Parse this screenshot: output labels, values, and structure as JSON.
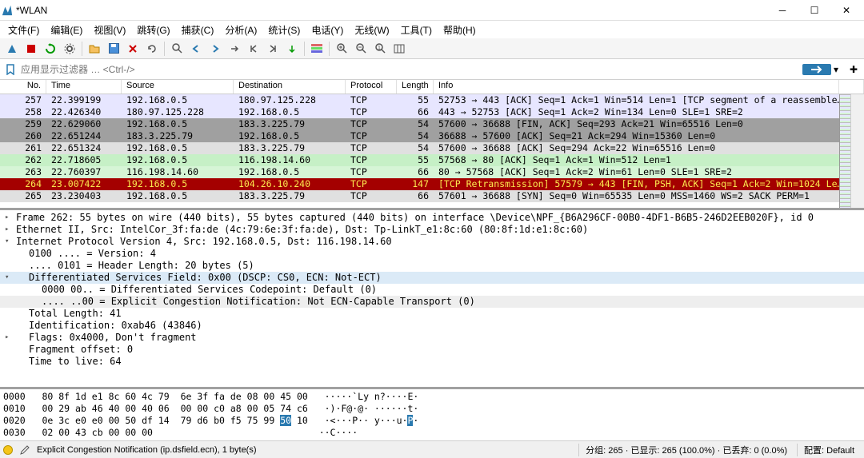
{
  "title": "*WLAN",
  "menus": [
    "文件(F)",
    "编辑(E)",
    "视图(V)",
    "跳转(G)",
    "捕获(C)",
    "分析(A)",
    "统计(S)",
    "电话(Y)",
    "无线(W)",
    "工具(T)",
    "帮助(H)"
  ],
  "filter_placeholder": "应用显示过滤器 … <Ctrl-/>",
  "columns": {
    "no": "No.",
    "time": "Time",
    "src": "Source",
    "dst": "Destination",
    "prot": "Protocol",
    "len": "Length",
    "info": "Info"
  },
  "packets": [
    {
      "no": "257",
      "time": "22.399199",
      "src": "192.168.0.5",
      "dst": "180.97.125.228",
      "prot": "TCP",
      "len": "55",
      "info": "52753 → 443 [ACK] Seq=1 Ack=1 Win=514 Len=1 [TCP segment of a reassemble…",
      "cls": "row-lavender"
    },
    {
      "no": "258",
      "time": "22.426340",
      "src": "180.97.125.228",
      "dst": "192.168.0.5",
      "prot": "TCP",
      "len": "66",
      "info": "443 → 52753 [ACK] Seq=1 Ack=2 Win=134 Len=0 SLE=1 SRE=2",
      "cls": "row-lavender"
    },
    {
      "no": "259",
      "time": "22.629060",
      "src": "192.168.0.5",
      "dst": "183.3.225.79",
      "prot": "TCP",
      "len": "54",
      "info": "57600 → 36688 [FIN, ACK] Seq=293 Ack=21 Win=65516 Len=0",
      "cls": "row-gray"
    },
    {
      "no": "260",
      "time": "22.651244",
      "src": "183.3.225.79",
      "dst": "192.168.0.5",
      "prot": "TCP",
      "len": "54",
      "info": "36688 → 57600 [ACK] Seq=21 Ack=294 Win=15360 Len=0",
      "cls": "row-gray"
    },
    {
      "no": "261",
      "time": "22.651324",
      "src": "192.168.0.5",
      "dst": "183.3.225.79",
      "prot": "TCP",
      "len": "54",
      "info": "57600 → 36688 [ACK] Seq=294 Ack=22 Win=65516 Len=0",
      "cls": "row-lightgray"
    },
    {
      "no": "262",
      "time": "22.718605",
      "src": "192.168.0.5",
      "dst": "116.198.14.60",
      "prot": "TCP",
      "len": "55",
      "info": "57568 → 80 [ACK] Seq=1 Ack=1 Win=512 Len=1",
      "cls": "row-green-sel"
    },
    {
      "no": "263",
      "time": "22.760397",
      "src": "116.198.14.60",
      "dst": "192.168.0.5",
      "prot": "TCP",
      "len": "66",
      "info": "80 → 57568 [ACK] Seq=1 Ack=2 Win=61 Len=0 SLE=1 SRE=2",
      "cls": "row-green"
    },
    {
      "no": "264",
      "time": "23.007422",
      "src": "192.168.0.5",
      "dst": "104.26.10.240",
      "prot": "TCP",
      "len": "147",
      "info": "[TCP Retransmission] 57579 → 443 [FIN, PSH, ACK] Seq=1 Ack=2 Win=1024 Le…",
      "cls": "row-red"
    },
    {
      "no": "265",
      "time": "23.230403",
      "src": "192.168.0.5",
      "dst": "183.3.225.79",
      "prot": "TCP",
      "len": "66",
      "info": "57601 → 36688 [SYN] Seq=0 Win=65535 Len=0 MSS=1460 WS=2 SACK PERM=1",
      "cls": "row-lightgray"
    }
  ],
  "details": {
    "frame": "Frame 262: 55 bytes on wire (440 bits), 55 bytes captured (440 bits) on interface \\Device\\NPF_{B6A296CF-00B0-4DF1-B6B5-246D2EEB020F}, id 0",
    "eth": "Ethernet II, Src: IntelCor_3f:fa:de (4c:79:6e:3f:fa:de), Dst: Tp-LinkT_e1:8c:60 (80:8f:1d:e1:8c:60)",
    "ip": "Internet Protocol Version 4, Src: 192.168.0.5, Dst: 116.198.14.60",
    "version": "0100 .... = Version: 4",
    "hlen": ".... 0101 = Header Length: 20 bytes (5)",
    "dsf": "Differentiated Services Field: 0x00 (DSCP: CS0, ECN: Not-ECT)",
    "dscp": "0000 00.. = Differentiated Services Codepoint: Default (0)",
    "ecn": ".... ..00 = Explicit Congestion Notification: Not ECN-Capable Transport (0)",
    "tlen": "Total Length: 41",
    "ident": "Identification: 0xab46 (43846)",
    "flags": "Flags: 0x4000, Don't fragment",
    "frag": "Fragment offset: 0",
    "ttl": "Time to live: 64"
  },
  "hex": {
    "r0": {
      "off": "0000",
      "bytes": "80 8f 1d e1 8c 60 4c 79  6e 3f fa de 08 00 45 00",
      "ascii": "·····`Ly n?····E·"
    },
    "r1": {
      "off": "0010",
      "bytes": "00 29 ab 46 40 00 40 06  00 00 c0 a8 00 05 74 c6",
      "ascii": "·)·F@·@· ······t·"
    },
    "r2": {
      "off": "0020",
      "bytes1": "0e 3c e0 e0 00 50 df 14  79 d6 b0 f5 75 99 ",
      "sel": "50",
      "bytes2": " 10",
      "ascii1": "·<···P·· y···u·",
      "asel": "P",
      "ascii2": "·"
    },
    "r3": {
      "off": "0030",
      "bytes": "02 00 43 cb 00 00 00",
      "ascii": "··C····"
    }
  },
  "status": {
    "field": "Explicit Congestion Notification (ip.dsfield.ecn), 1 byte(s)",
    "pkts": "分组: 265 · 已显示: 265 (100.0%) · 已丢弃: 0 (0.0%)",
    "profile": "配置: Default"
  }
}
